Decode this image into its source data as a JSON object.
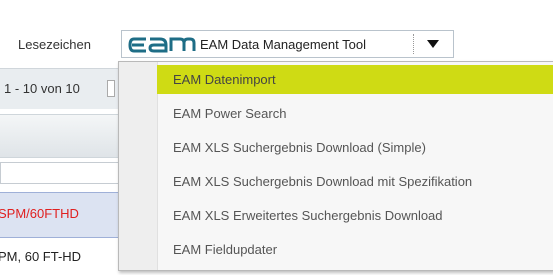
{
  "toolbar": {
    "bookmarks_label": "Lesezeichen",
    "logo_text": "eam",
    "selected_tool": "EAM Data Management Tool"
  },
  "background": {
    "pager_text": "1 - 10 von 10",
    "row1_text": "SPM/60FTHD",
    "row2_text": "PM, 60 FT-HD"
  },
  "dropdown": {
    "items": [
      {
        "label": "EAM Datenimport",
        "highlighted": true
      },
      {
        "label": "EAM Power Search"
      },
      {
        "label": "EAM XLS Suchergebnis Download (Simple)"
      },
      {
        "label": "EAM XLS Suchergebnis Download mit Spezifikation"
      },
      {
        "label": "EAM XLS Erweitertes Suchergebnis Download"
      },
      {
        "label": "EAM Fieldupdater"
      }
    ]
  },
  "colors": {
    "highlight": "#cfdb14",
    "logo": "#1e6d86",
    "row_error_text": "#e02020"
  }
}
